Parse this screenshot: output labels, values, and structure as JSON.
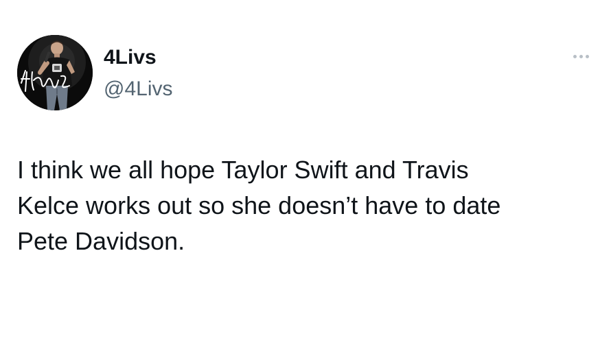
{
  "author": {
    "display_name": "4Livs",
    "handle": "@4Livs",
    "avatar_icon": "profile-photo-performer-with-signature",
    "avatar_signature_text": "4Livs"
  },
  "tweet": {
    "text": "I think we all hope Taylor Swift and Travis\nKelce works out so she doesn’t have to date\nPete Davidson."
  },
  "menu": {
    "more_icon": "ellipsis-icon"
  },
  "colors": {
    "background": "#ffffff",
    "text_primary": "#0f1419",
    "text_secondary": "#536471",
    "menu_dots": "#b8bfc6",
    "avatar_background": "#0b0b0b"
  }
}
